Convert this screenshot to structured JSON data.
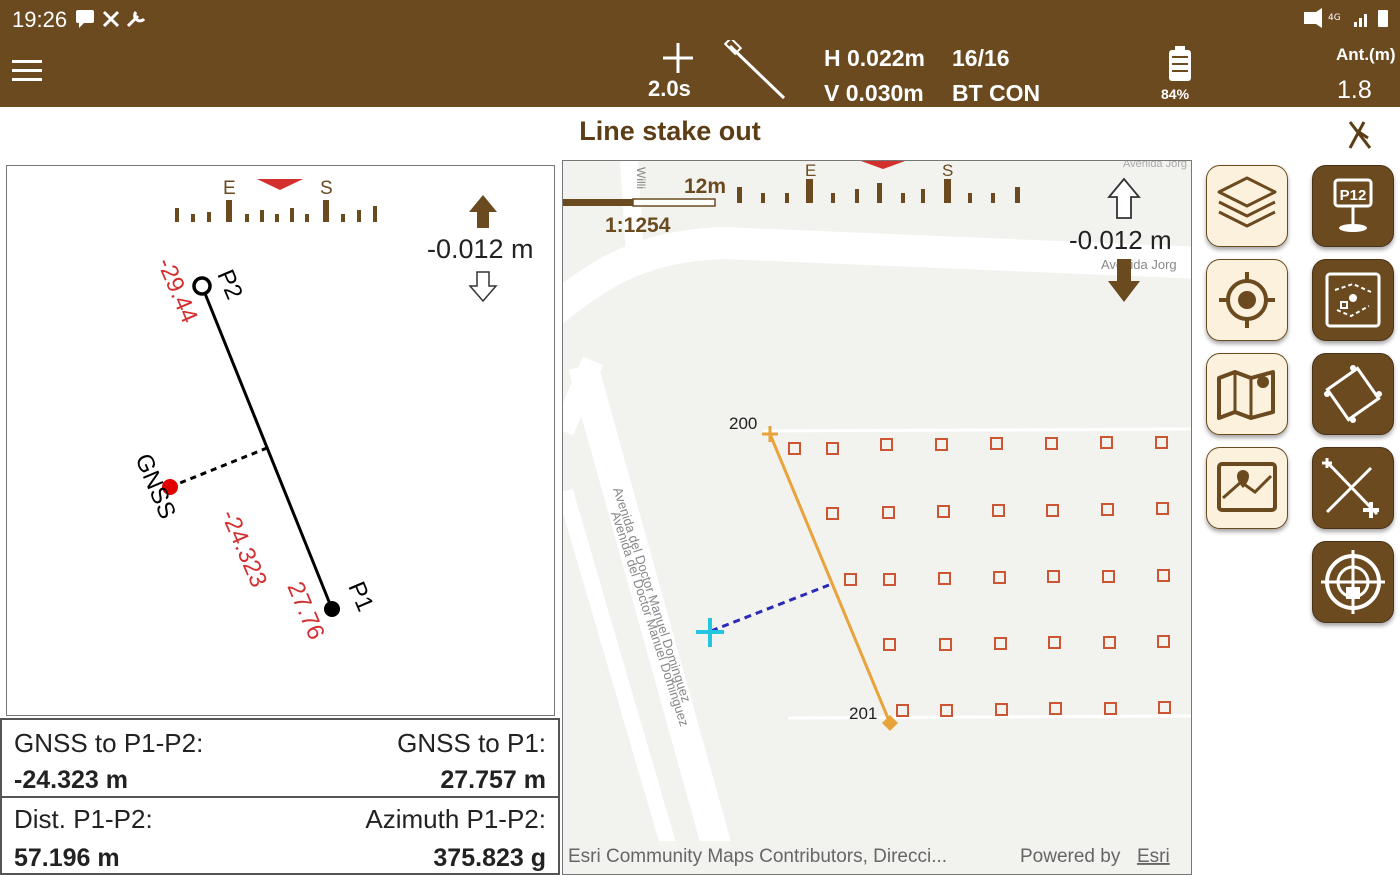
{
  "status_bar": {
    "time": "19:26"
  },
  "toolbar": {
    "interval": "2.0s",
    "h_precision": "H 0.022m",
    "v_precision": "V 0.030m",
    "satellites": "16/16",
    "connection": "BT CON",
    "battery": "84%",
    "antenna_label": "Ant.(m)",
    "antenna_value": "1.8"
  },
  "screen_title": "Line stake out",
  "left_view": {
    "compass": {
      "east": "E",
      "south": "S"
    },
    "height_offset": "-0.012 m",
    "points": {
      "p2": "P2",
      "p1": "P1",
      "gnss": "GNSS"
    },
    "dist_to_p2": "-29.44",
    "dist_to_line": "-24.323",
    "dist_to_p1": "27.76"
  },
  "map_view": {
    "scale_distance": "12m",
    "scale_ratio": "1:1254",
    "compass": {
      "east": "E",
      "south": "S"
    },
    "height_offset": "-0.012 m",
    "street_avenida_jorge": "Avenida Jorg",
    "street_top": "Avenida Jorg",
    "street_doctor_1": "Avenida del Doctor Manuel Dominguez",
    "street_doctor_2": "Avenida del Doctor Manuel Dominguez",
    "street_vertical": "Willi",
    "point_200": "200",
    "point_201": "201",
    "attribution": "Esri Community Maps Contributors, Direcci...",
    "powered_by": "Powered by",
    "esri_link": "Esri"
  },
  "info": {
    "gnss_line_label": "GNSS to P1-P2:",
    "gnss_line_value": "-24.323 m",
    "gnss_p1_label": "GNSS to P1:",
    "gnss_p1_value": "27.757 m",
    "dist_label": "Dist. P1-P2:",
    "dist_value": "57.196 m",
    "azimuth_label": "Azimuth P1-P2:",
    "azimuth_value": "375.823 g"
  },
  "tools_left": [
    "layers-icon",
    "locate-icon",
    "map-icon",
    "map-view-icon"
  ],
  "tools_right": [
    "p12-point-icon",
    "survey-map-icon",
    "rectangle-icon",
    "line-add-icon",
    "target-icon"
  ],
  "colors": {
    "brand": "#6b4a20",
    "button_light": "#fbf1dc",
    "distance_red": "#d32f2f",
    "stake_line": "#e8a33a",
    "grid_point": "#cc5533",
    "offset_line": "#2a2ab8",
    "gnss_cursor": "#22c6e0"
  }
}
